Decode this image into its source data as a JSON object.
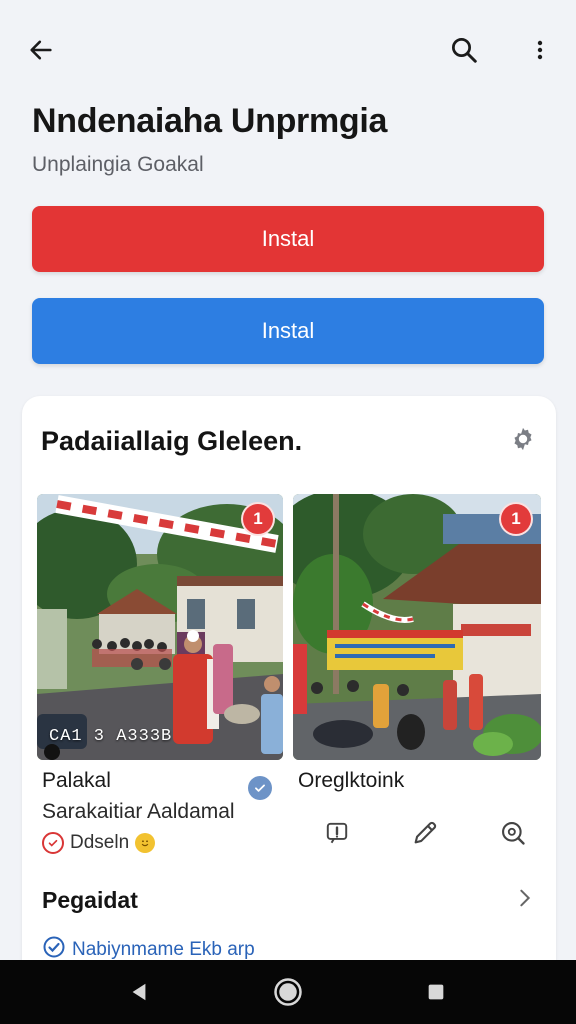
{
  "topbar": {
    "back_icon": "arrow-left-icon",
    "search_icon": "search-icon",
    "more_icon": "more-vertical-icon"
  },
  "app": {
    "title": "Nndenaiaha Unprmgia",
    "subtitle": "Unplaingia Goakal"
  },
  "buttons": {
    "primary_label": "Instal",
    "secondary_label": "Instal",
    "primary_color": "#e33535",
    "secondary_color": "#2d7ee2"
  },
  "gallery": {
    "title": "Padaiiallaig Gleleen.",
    "settings_icon": "gear-icon",
    "photos": [
      {
        "badge": "1",
        "overlay_code": "CA1 3 A333B",
        "title": "Palakal",
        "subtitle": "Sarakaitiar Aaldamal",
        "verified_icon": "check-badge-icon",
        "status_text": "Ddseln",
        "status_icon": "alert-circle-icon",
        "emoji_icon": "smile-emoji-icon"
      },
      {
        "badge": "1",
        "title": "Oreglktoink",
        "actions": [
          "report-icon",
          "edit-pen-icon",
          "zoom-search-icon"
        ]
      }
    ],
    "section_title": "Pegaidat",
    "section_chevron": "chevron-right-icon",
    "link_text": "Nabiynmame Ekb arp",
    "link_icon": "check-circle-icon"
  },
  "navbar": {
    "back": "nav-back-icon",
    "home": "nav-home-icon",
    "recent": "nav-recent-icon"
  }
}
